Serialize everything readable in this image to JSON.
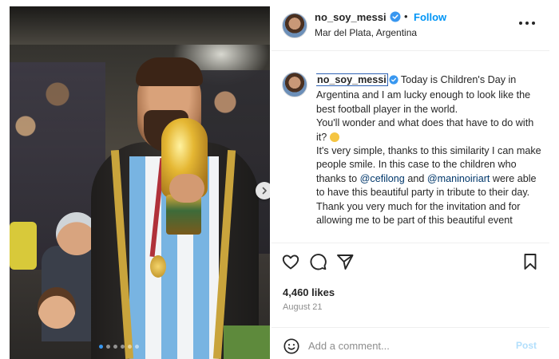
{
  "post": {
    "username": "no_soy_messi",
    "follow_label": "Follow",
    "separator": "•",
    "location": "Mar del Plata, Argentina",
    "caption": {
      "username": "no_soy_messi",
      "text_1": "Today is Children's Day in Argentina and I am lucky enough to look like the best football player in the world.",
      "text_2": "You'll wonder and what does that have to do with it?",
      "emoji_icon": "thinking-face-emoji",
      "text_3": "It's very simple, thanks to this similarity I can make people smile. In this case to the children who thanks to",
      "mention_1": "@cefilong",
      "and": "and",
      "mention_2": "@maninoiriart",
      "text_4": "were able to have this beautiful party in tribute to their day.",
      "text_5": "Thank you very much for the invitation and for allowing me to be part of this beautiful event"
    },
    "likes": "4,460 likes",
    "date": "August 21",
    "comment_placeholder": "Add a comment...",
    "post_label": "Post",
    "carousel": {
      "slides": 6,
      "active_index": 0
    }
  },
  "icons": {
    "verified": "verified-badge-icon",
    "more": "more-options-icon",
    "like": "heart-icon",
    "comment": "comment-icon",
    "share": "share-icon",
    "save": "bookmark-icon",
    "emoji": "smiley-icon",
    "next": "chevron-right-icon"
  },
  "colors": {
    "link_blue": "#0095f6",
    "verified_blue": "#3897f0",
    "mention_blue": "#00376b",
    "highlight_box": "#2f63b5",
    "post_disabled": "#b2dffc"
  }
}
